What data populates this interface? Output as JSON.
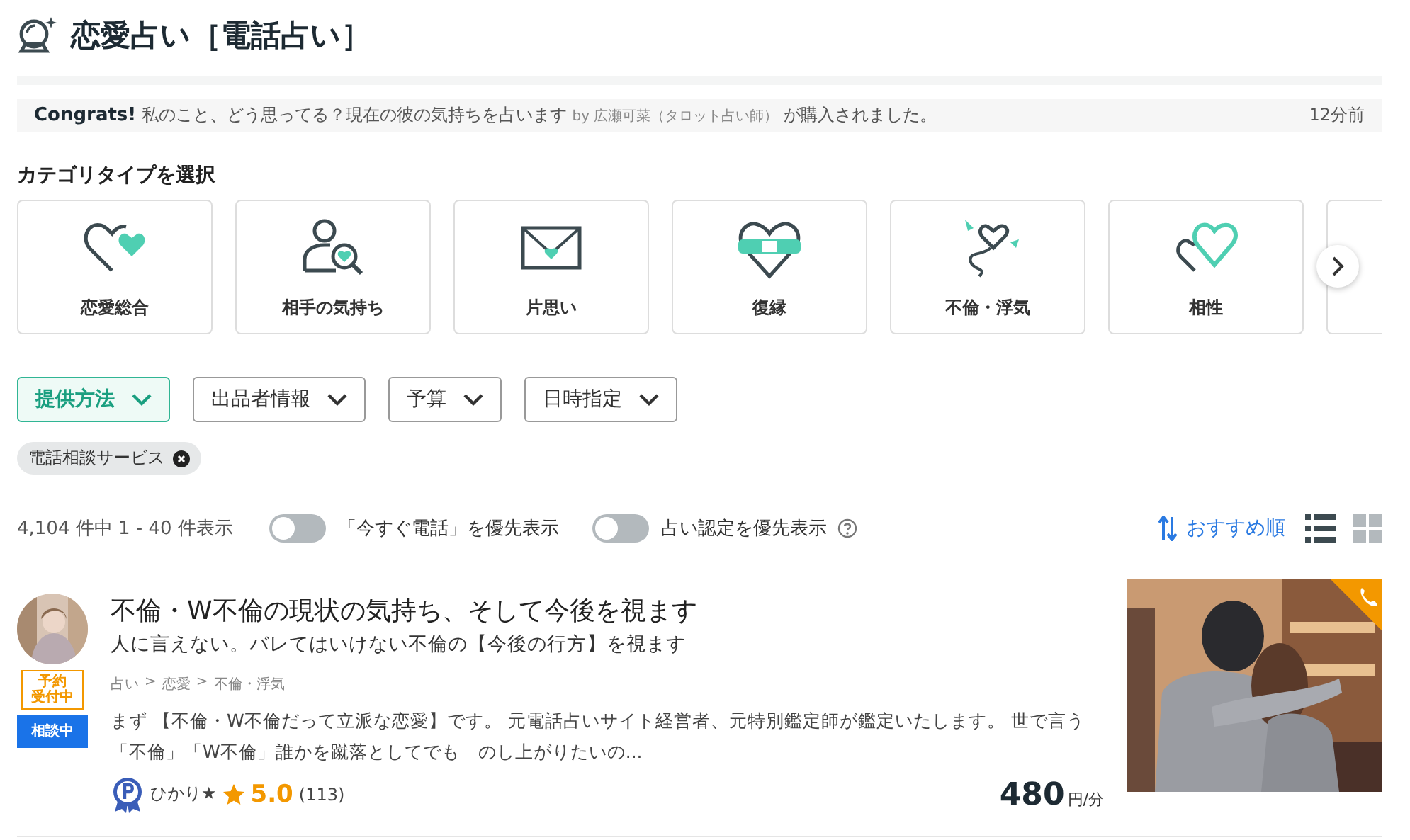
{
  "page_title": "恋愛占い［電話占い］",
  "notice": {
    "lead": "Congrats!",
    "message": "私のこと、どう思ってる？現在の彼の気持ちを占います",
    "by": "by 広瀬可菜（タロット占い師）",
    "tail": "が購入されました。",
    "time": "12分前"
  },
  "categories": {
    "heading": "カテゴリタイプを選択",
    "items": [
      {
        "label": "恋愛総合",
        "kind": "hearts"
      },
      {
        "label": "相手の気持ち",
        "kind": "search"
      },
      {
        "label": "片思い",
        "kind": "letter"
      },
      {
        "label": "復縁",
        "kind": "bandage"
      },
      {
        "label": "不倫・浮気",
        "kind": "flying"
      },
      {
        "label": "相性",
        "kind": "pair"
      }
    ]
  },
  "filters": [
    {
      "label": "提供方法",
      "selected": true
    },
    {
      "label": "出品者情報",
      "selected": false
    },
    {
      "label": "予算",
      "selected": false
    },
    {
      "label": "日時指定",
      "selected": false
    }
  ],
  "chips": [
    {
      "label": "電話相談サービス"
    }
  ],
  "results": {
    "count": "4,104 件中 1 - 40 件表示",
    "toggles": [
      {
        "label": "「今すぐ電話」を優先表示",
        "on": false,
        "help": false
      },
      {
        "label": "占い認定を優先表示",
        "on": false,
        "help": true
      }
    ],
    "sort": "おすすめ順",
    "views": [
      {
        "kind": "list",
        "selected": true
      },
      {
        "kind": "grid",
        "selected": false
      }
    ]
  },
  "listings": [
    {
      "badges": [
        {
          "lines": [
            "予約",
            "受付中"
          ],
          "kind": "outline"
        },
        {
          "lines": [
            "相談中"
          ],
          "kind": "solid"
        }
      ],
      "title": "不倫・W不倫の現状の気持ち、そして今後を視ます",
      "subtitle": "人に言えない。バレてはいけない不倫の【今後の行方】を視ます",
      "breadcrumb": [
        "占い",
        "恋愛",
        "不倫・浮気"
      ],
      "breadcrumb_separator": ">",
      "description": "まず 【不倫・W不倫だって立派な恋愛】です。 元電話占いサイト経営者、元特別鑑定師が鑑定いたします。 世で言う「不倫」「W不倫」誰かを蹴落としてでも　のし上がりたいの...",
      "seller": "ひかり★",
      "rating": "5.0",
      "reviews": "(113)",
      "price": "480",
      "unit": "円/分",
      "phone": true
    }
  ]
}
